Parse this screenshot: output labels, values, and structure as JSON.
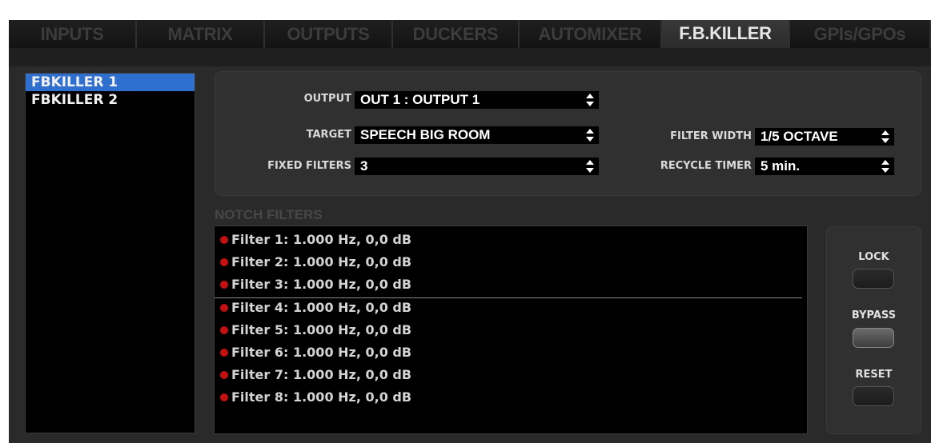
{
  "tabs": [
    {
      "label": "INPUTS"
    },
    {
      "label": "MATRIX"
    },
    {
      "label": "OUTPUTS"
    },
    {
      "label": "DUCKERS"
    },
    {
      "label": "AUTOMIXER"
    },
    {
      "label": "F.B.KILLER"
    },
    {
      "label": "GPIs/GPOs"
    }
  ],
  "active_tab": "F.B.KILLER",
  "sidebar": {
    "items": [
      {
        "label": "FBKILLER 1",
        "selected": true
      },
      {
        "label": "FBKILLER 2",
        "selected": false
      }
    ]
  },
  "settings": {
    "output": {
      "label": "OUTPUT",
      "value": "OUT 1 : OUTPUT 1"
    },
    "target": {
      "label": "TARGET",
      "value": "SPEECH BIG ROOM"
    },
    "fixed_filters": {
      "label": "FIXED FILTERS",
      "value": "3"
    },
    "filter_width": {
      "label": "FILTER WIDTH",
      "value": "1/5 OCTAVE"
    },
    "recycle_timer": {
      "label": "RECYCLE TIMER",
      "value": "5 min."
    }
  },
  "notch": {
    "title": "NOTCH FILTERS",
    "filters": [
      "Filter 1: 1.000 Hz, 0,0 dB",
      "Filter 2: 1.000 Hz, 0,0 dB",
      "Filter 3: 1.000 Hz, 0,0 dB",
      "Filter 4: 1.000 Hz, 0,0 dB",
      "Filter 5: 1.000 Hz, 0,0 dB",
      "Filter 6: 1.000 Hz, 0,0 dB",
      "Filter 7: 1.000 Hz, 0,0 dB",
      "Filter 8: 1.000 Hz, 0,0 dB"
    ],
    "fixed_count": 3
  },
  "buttons": {
    "lock": "LOCK",
    "bypass": "BYPASS",
    "reset": "RESET"
  },
  "colors": {
    "selection": "#2f6fcd",
    "filter_dot": "#c41010",
    "background": "#2a2a2a"
  }
}
